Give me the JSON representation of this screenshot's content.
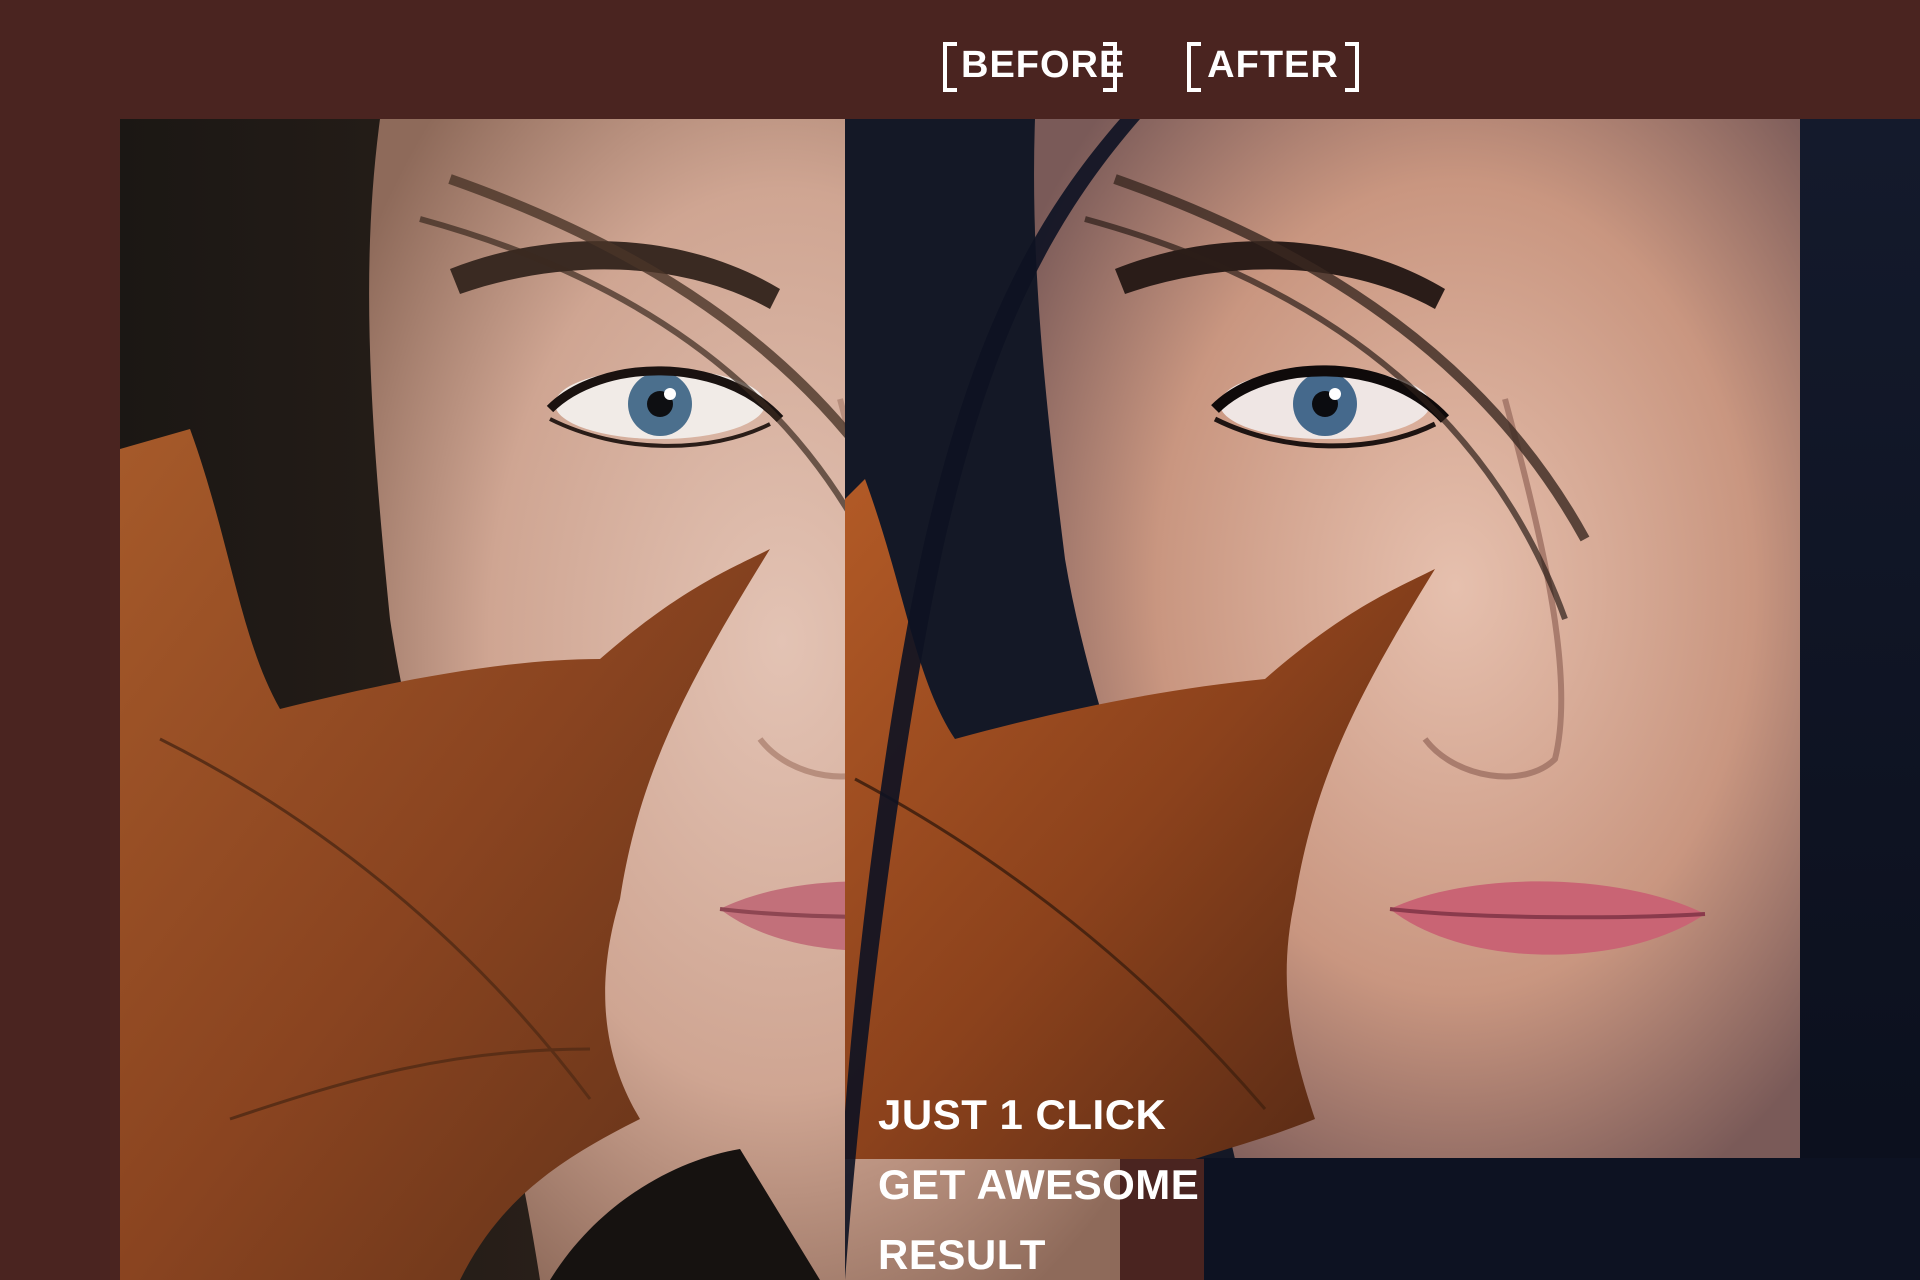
{
  "header": {
    "before_label": "BEFORE",
    "after_label": "AFTER"
  },
  "caption": {
    "line1": "JUST 1 CLICK",
    "line2": "GET AWESOME",
    "line3": "RESULT"
  },
  "colors": {
    "background": "#4a2420",
    "label_text": "#ffffff",
    "after_tint": "#0d1222",
    "leaf": "#8a4a22",
    "skin": "#d8b5a3"
  },
  "icons": {
    "before_bracket": "corner-bracket-icon",
    "after_bracket": "corner-bracket-icon"
  }
}
